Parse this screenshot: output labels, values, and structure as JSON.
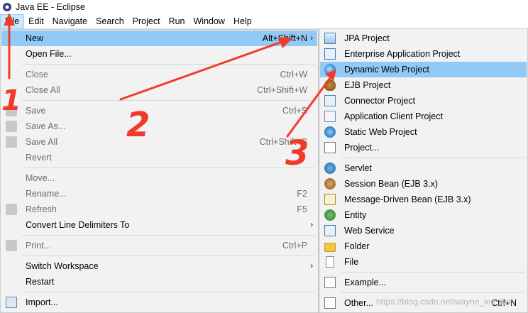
{
  "window": {
    "title": "Java EE - Eclipse"
  },
  "menubar": {
    "items": [
      "File",
      "Edit",
      "Navigate",
      "Search",
      "Project",
      "Run",
      "Window",
      "Help"
    ]
  },
  "file_menu": {
    "items": [
      {
        "label": "New",
        "accel": "Alt+Shift+N",
        "submenu": true,
        "highlighted": true
      },
      {
        "label": "Open File...",
        "accel": ""
      },
      {
        "label": "Close",
        "accel": "Ctrl+W",
        "disabled": true
      },
      {
        "label": "Close All",
        "accel": "Ctrl+Shift+W",
        "disabled": true
      },
      {
        "label": "Save",
        "accel": "Ctrl+S",
        "disabled": true
      },
      {
        "label": "Save As...",
        "accel": "",
        "disabled": true
      },
      {
        "label": "Save All",
        "accel": "Ctrl+Shift+S",
        "disabled": true
      },
      {
        "label": "Revert",
        "accel": "",
        "disabled": true
      },
      {
        "label": "Move...",
        "accel": "",
        "disabled": true
      },
      {
        "label": "Rename...",
        "accel": "F2",
        "disabled": true
      },
      {
        "label": "Refresh",
        "accel": "F5",
        "disabled": true
      },
      {
        "label": "Convert Line Delimiters To",
        "accel": "",
        "submenu": true
      },
      {
        "label": "Print...",
        "accel": "Ctrl+P",
        "disabled": true
      },
      {
        "label": "Switch Workspace",
        "accel": "",
        "submenu": true
      },
      {
        "label": "Restart",
        "accel": ""
      },
      {
        "label": "Import...",
        "accel": ""
      }
    ]
  },
  "new_submenu": {
    "items": [
      {
        "label": "JPA Project",
        "icon": "jpa-project-icon"
      },
      {
        "label": "Enterprise Application Project",
        "icon": "enterprise-app-icon"
      },
      {
        "label": "Dynamic Web Project",
        "icon": "dynamic-web-project-icon",
        "highlighted": true
      },
      {
        "label": "EJB Project",
        "icon": "ejb-project-icon"
      },
      {
        "label": "Connector Project",
        "icon": "connector-project-icon"
      },
      {
        "label": "Application Client Project",
        "icon": "app-client-project-icon"
      },
      {
        "label": "Static Web Project",
        "icon": "static-web-project-icon"
      },
      {
        "label": "Project...",
        "icon": "project-icon"
      },
      {
        "label": "Servlet",
        "icon": "servlet-icon"
      },
      {
        "label": "Session Bean (EJB 3.x)",
        "icon": "session-bean-icon"
      },
      {
        "label": "Message-Driven Bean (EJB 3.x)",
        "icon": "message-driven-bean-icon"
      },
      {
        "label": "Entity",
        "icon": "entity-icon"
      },
      {
        "label": "Web Service",
        "icon": "web-service-icon"
      },
      {
        "label": "Folder",
        "icon": "folder-icon"
      },
      {
        "label": "File",
        "icon": "file-icon"
      },
      {
        "label": "Example...",
        "icon": "example-icon"
      },
      {
        "label": "Other...",
        "icon": "other-icon",
        "accel": "Ctrl+N"
      }
    ]
  },
  "annotations": {
    "step1": "1",
    "step2": "2",
    "step3": "3",
    "color": "#f23a2a"
  },
  "watermark": "https://blog.csdn.net/wayne_lee_lwc",
  "colors": {
    "highlight": "#91c9f7",
    "menu_bg": "#f2f2f2"
  }
}
